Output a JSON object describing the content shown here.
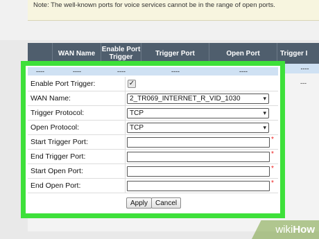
{
  "note": {
    "text": "Note: The well-known ports for voice services cannot be in the range of open ports."
  },
  "table": {
    "headers": [
      "",
      "WAN Name",
      "Enable Port Trigger",
      "Trigger Port",
      "Open Port",
      "Trigger I"
    ],
    "empty_row": [
      "----",
      "----",
      "----",
      "----",
      "----",
      "----"
    ],
    "right_dash": "---"
  },
  "form": {
    "header_dashes": [
      "----",
      "----",
      "----",
      "----",
      "----"
    ],
    "enable_port_trigger": {
      "label": "Enable Port Trigger:",
      "checked": true,
      "check_glyph": "✓"
    },
    "wan_name": {
      "label": "WAN Name:",
      "value": "2_TR069_INTERNET_R_VID_1030"
    },
    "trigger_protocol": {
      "label": "Trigger Protocol:",
      "value": "TCP"
    },
    "open_protocol": {
      "label": "Open Protocol:",
      "value": "TCP"
    },
    "start_trigger_port": {
      "label": "Start Trigger Port:",
      "value": ""
    },
    "end_trigger_port": {
      "label": "End Trigger Port:",
      "value": ""
    },
    "start_open_port": {
      "label": "Start Open Port:",
      "value": ""
    },
    "end_open_port": {
      "label": "End Open Port:",
      "value": ""
    },
    "required_mark": "*",
    "apply_label": "Apply",
    "cancel_label": "Cancel"
  },
  "watermark": {
    "wiki": "wiki",
    "how": "How"
  },
  "colors": {
    "highlight": "#3ee03a",
    "header_bg": "#4f5e6d",
    "row_bg": "#cfe1f3"
  },
  "icons": {
    "select_arrow": "chevron-down-icon",
    "checkbox": "checkbox-checked-icon"
  }
}
